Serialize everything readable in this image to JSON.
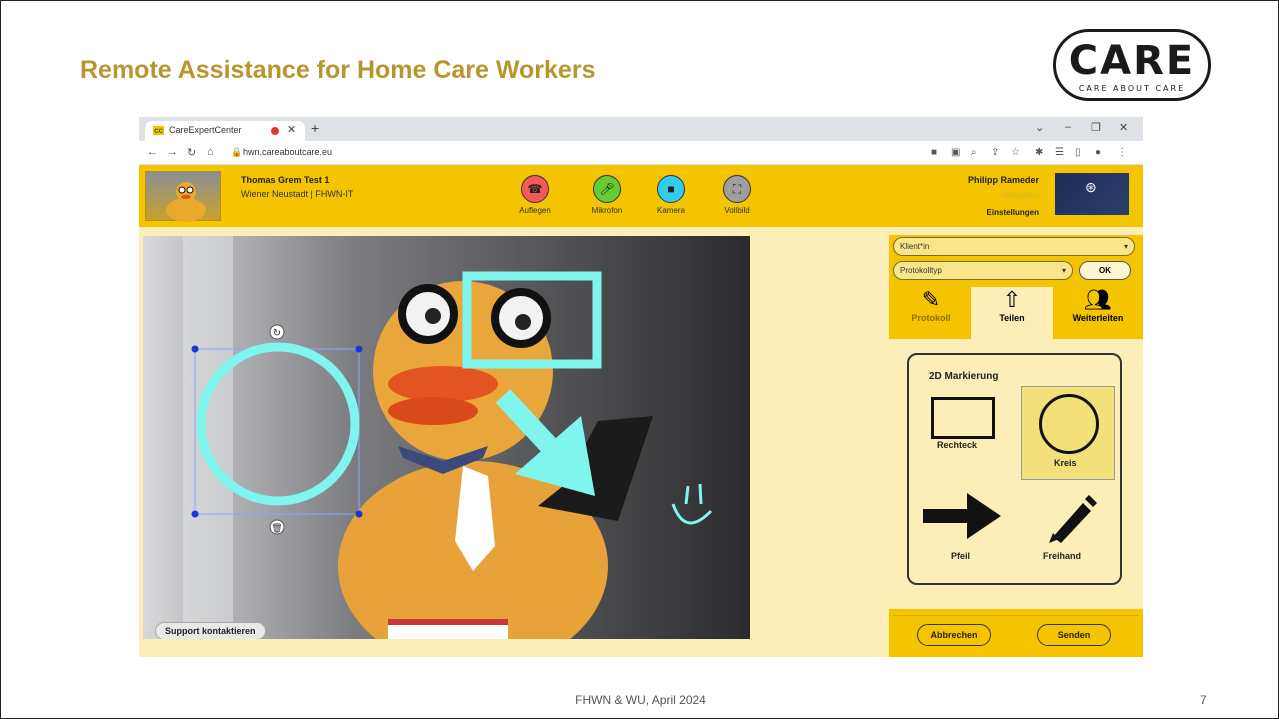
{
  "slide": {
    "title": "Remote Assistance for Home Care Workers",
    "logo_word": "CARE",
    "logo_tagline": "CARE ABOUT CARE",
    "footer": "FHWN & WU, April 2024",
    "page_number": "7"
  },
  "browser": {
    "tab_title": "CareExpertCenter",
    "tab_favicon": "cc",
    "url": "hwn.careaboutcare.eu"
  },
  "app_header": {
    "caller_name": "Thomas Grem Test 1",
    "caller_location": "Wiener Neustadt | FHWN-IT",
    "controls": [
      {
        "label": "Auflegen",
        "icon": "hang-up-icon",
        "color": "#f25a5a"
      },
      {
        "label": "Mikrofon",
        "icon": "microphone-icon",
        "color": "#66cc33"
      },
      {
        "label": "Kamera",
        "icon": "camera-icon",
        "color": "#33ccee"
      },
      {
        "label": "Vollbild",
        "icon": "fullscreen-icon",
        "color": "#9e9e9e"
      }
    ],
    "user_name": "Philipp Rameder",
    "logout_label": "Abmelden",
    "settings_label": "Einstellungen"
  },
  "video": {
    "support_button": "Support kontaktieren",
    "annotation_color": "#7ff5ee"
  },
  "panel": {
    "client_select": "Klient*in",
    "protocol_select": "Protokolltyp",
    "ok_label": "OK",
    "tabs": [
      {
        "label": "Protokoll",
        "icon": "protocol-icon"
      },
      {
        "label": "Teilen",
        "icon": "share-icon"
      },
      {
        "label": "Weiterleiten",
        "icon": "forward-icon"
      }
    ],
    "markings_title": "2D Markierung",
    "tools": {
      "rectangle": "Rechteck",
      "circle": "Kreis",
      "arrow": "Pfeil",
      "freehand": "Freihand"
    },
    "cancel_label": "Abbrechen",
    "send_label": "Senden"
  },
  "colors": {
    "title_gold": "#B8962E",
    "app_yellow": "#f5c400",
    "panel_light": "#fdeeb8"
  }
}
